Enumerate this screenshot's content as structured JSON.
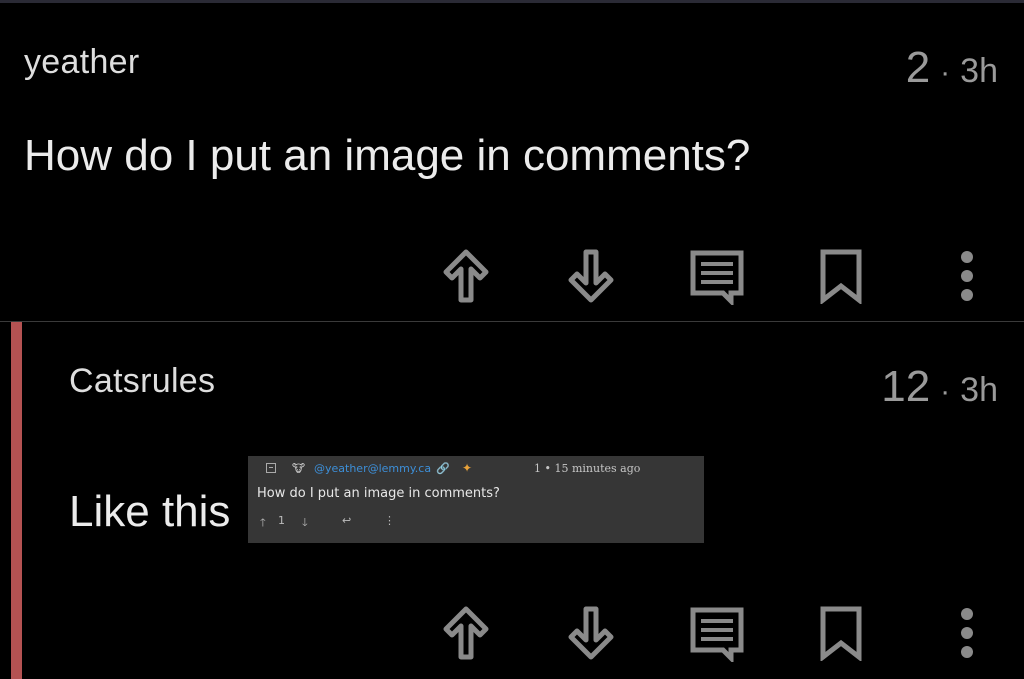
{
  "post": {
    "author": "yeather",
    "score": "2",
    "separator": "·",
    "age": "3h",
    "text": "How do I put an image in comments?"
  },
  "reply": {
    "author": "Catsrules",
    "score": "12",
    "separator": "·",
    "age": "3h",
    "text": "Like this",
    "image": {
      "user": "@yeather@lemmy.ca",
      "meta": "1 • 15 minutes ago",
      "text": "How do I put an image in comments?",
      "upvote_count": "1"
    }
  },
  "icons": {
    "upvote": "arrow-up-icon",
    "downvote": "arrow-down-icon",
    "reply": "comment-icon",
    "save": "bookmark-icon",
    "more": "more-vertical-icon"
  },
  "colors": {
    "background": "#000000",
    "text": "#ececec",
    "muted": "#9a9a9a",
    "icon": "#8a8a8a",
    "thread_bar": "#b45252",
    "link": "#3d8fd8"
  }
}
